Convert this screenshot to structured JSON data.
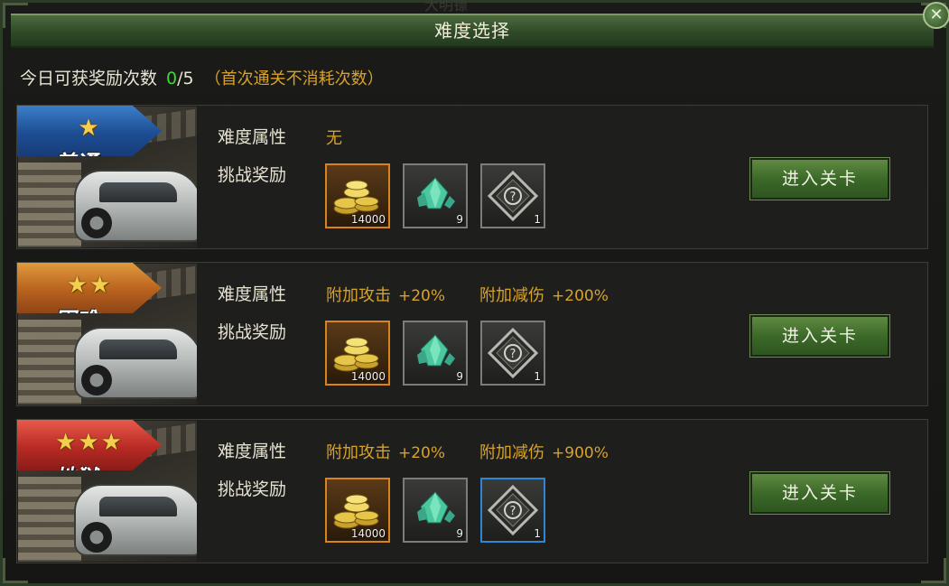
{
  "window": {
    "title": "难度选择",
    "faded_header": "大明镖"
  },
  "daily": {
    "label": "今日可获奖励次数",
    "current": "0",
    "total": "/5",
    "note": "（首次通关不消耗次数）"
  },
  "common": {
    "attr_label": "难度属性",
    "reward_label": "挑战奖励",
    "enter_label": "进入关卡"
  },
  "difficulties": [
    {
      "name": "普通",
      "stars": "★",
      "banner_color": "#1d4d93",
      "attr_none": "无",
      "rewards": [
        {
          "icon": "gold-coins-icon",
          "qty": "14000"
        },
        {
          "icon": "green-crystal-icon",
          "qty": "9"
        },
        {
          "icon": "mystery-box-icon",
          "qty": "1"
        }
      ]
    },
    {
      "name": "困难",
      "stars": "★★",
      "banner_color": "#b8611e",
      "attr1_name": "附加攻击",
      "attr1_value": "+20%",
      "attr2_name": "附加减伤",
      "attr2_value": "+200%",
      "rewards": [
        {
          "icon": "gold-coins-icon",
          "qty": "14000"
        },
        {
          "icon": "green-crystal-icon",
          "qty": "9"
        },
        {
          "icon": "mystery-box-icon",
          "qty": "1"
        }
      ]
    },
    {
      "name": "地狱",
      "stars": "★★★",
      "banner_color": "#b82a24",
      "attr1_name": "附加攻击",
      "attr1_value": "+20%",
      "attr2_name": "附加减伤",
      "attr2_value": "+900%",
      "rewards": [
        {
          "icon": "gold-coins-icon",
          "qty": "14000"
        },
        {
          "icon": "green-crystal-icon",
          "qty": "9"
        },
        {
          "icon": "mystery-box-icon",
          "qty": "1"
        }
      ]
    }
  ],
  "colors": {
    "accent_gold": "#d8a22a",
    "count_green": "#3fd63a",
    "button_green": "#3c6a28"
  }
}
